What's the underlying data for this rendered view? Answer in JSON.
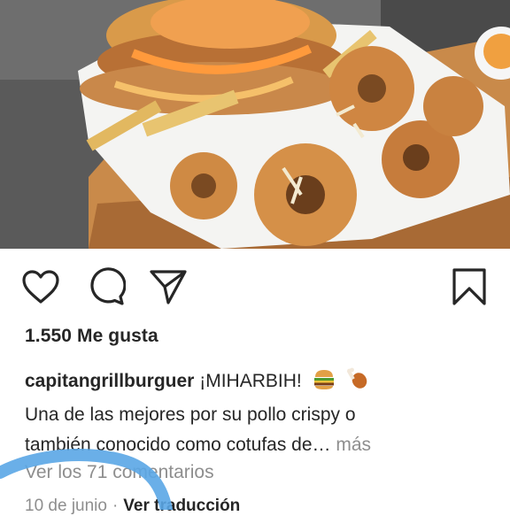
{
  "post": {
    "photo_description_icon": "food-photo",
    "likes_text": "1.550 Me gusta",
    "username": "capitangrillburguer",
    "caption_title": "¡MIHARBIH!",
    "caption_emojis": [
      "hamburger-icon",
      "chicken-leg-icon"
    ],
    "caption_line1": "Una de las mejores por su pollo crispy o",
    "caption_line2": "también conocido como cotufas de…",
    "more_label": "más",
    "view_comments": "Ver los 71 comentarios",
    "date": "10 de junio",
    "separator": "·",
    "translate_label": "Ver traducción"
  },
  "actions": {
    "like": "heart-icon",
    "comment": "comment-bubble-icon",
    "share": "paper-plane-icon",
    "save": "bookmark-icon"
  },
  "colors": {
    "text": "#262626",
    "muted": "#8e8e8e",
    "annotation": "#5aa6e6"
  }
}
